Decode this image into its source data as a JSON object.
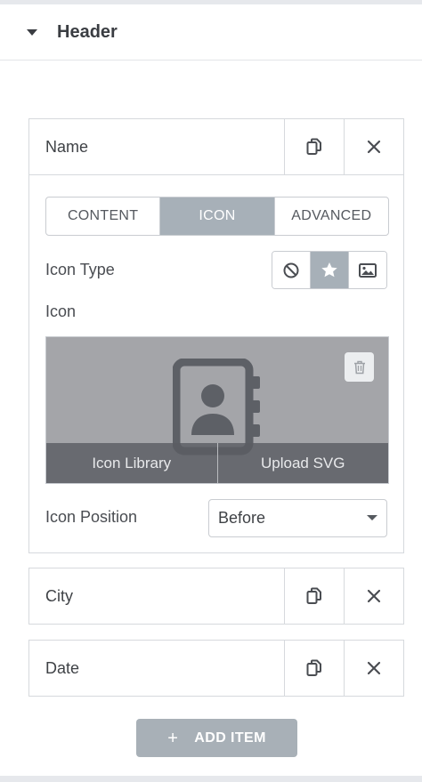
{
  "header": {
    "title": "Header"
  },
  "items": [
    {
      "title": "Name",
      "expanded": true
    },
    {
      "title": "City",
      "expanded": false
    },
    {
      "title": "Date",
      "expanded": false
    }
  ],
  "editor": {
    "tabs": [
      {
        "label": "CONTENT",
        "active": false
      },
      {
        "label": "ICON",
        "active": true
      },
      {
        "label": "ADVANCED",
        "active": false
      }
    ],
    "icon_type": {
      "label": "Icon Type",
      "options": [
        {
          "icon": "none-icon",
          "active": false
        },
        {
          "icon": "star-icon",
          "active": true
        },
        {
          "icon": "image-icon",
          "active": false
        }
      ]
    },
    "icon": {
      "label": "Icon",
      "preview_icon": "address-book-icon",
      "library_label": "Icon Library",
      "upload_label": "Upload SVG"
    },
    "icon_position": {
      "label": "Icon Position",
      "value": "Before"
    }
  },
  "add_button": {
    "label": "ADD ITEM"
  },
  "colors": {
    "active_tab": "#a7b0b8",
    "preview_bg": "#a4a5a9",
    "add_button": "#a8b0b7",
    "border": "#d6d9dd"
  }
}
